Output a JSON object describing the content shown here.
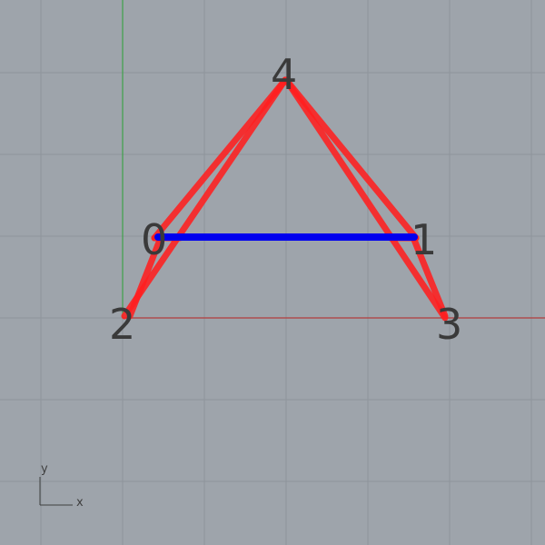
{
  "viewport": {
    "background_color": "#9ea4ab",
    "grid_color": "#8e949b",
    "x_axis_color": "#b23c3c",
    "y_axis_color": "#3fa04a"
  },
  "vertices": [
    {
      "label": "0"
    },
    {
      "label": "1"
    },
    {
      "label": "2"
    },
    {
      "label": "3"
    },
    {
      "label": "4"
    }
  ],
  "edges": {
    "red_color": "#ff1f1f",
    "blue_color": "#0000ee"
  },
  "axis_indicator": {
    "x_label": "x",
    "y_label": "y"
  }
}
